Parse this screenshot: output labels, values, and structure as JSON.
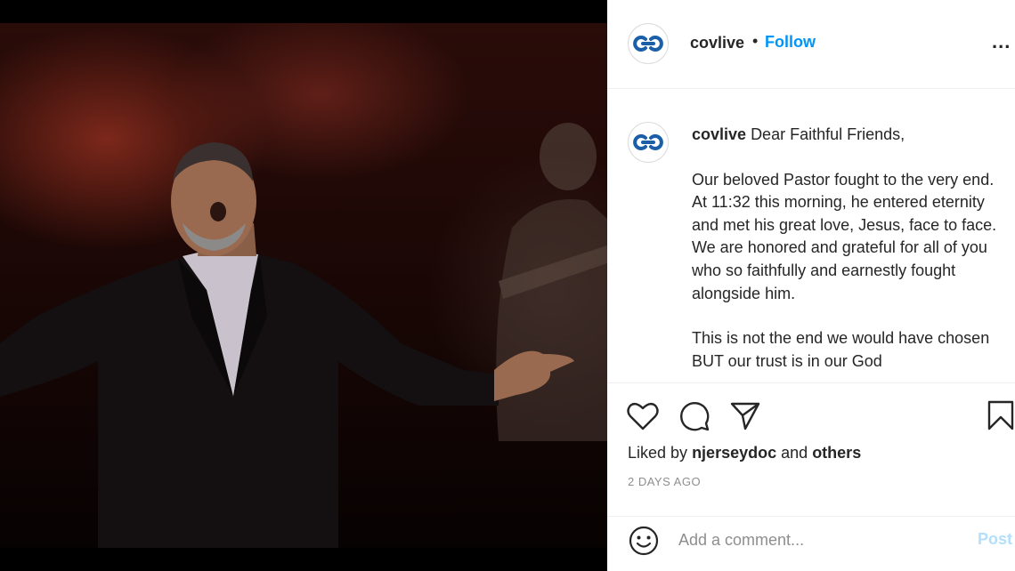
{
  "header": {
    "username": "covlive",
    "separator": "•",
    "follow_label": "Follow",
    "more_label": "..."
  },
  "caption": {
    "username": "covlive",
    "paragraphs": [
      "Dear Faithful Friends,",
      "Our beloved Pastor fought to the very end. At 11:32 this morning, he entered eternity and met his great love, Jesus, face to face. We are honored and grateful for all of you who so faithfully and earnestly fought alongside him.",
      "This is not the end we would have chosen BUT our trust is in our God"
    ]
  },
  "actions": {
    "icons": [
      "heart-icon",
      "comment-icon",
      "share-icon",
      "bookmark-icon"
    ],
    "liked_by_prefix": "Liked by",
    "liked_by_user": "njerseydoc",
    "liked_by_and": "and",
    "liked_by_others": "others",
    "timestamp": "2 DAYS AGO"
  },
  "comment": {
    "placeholder": "Add a comment...",
    "post_label": "Post"
  },
  "colors": {
    "accent": "#0095f6",
    "post_disabled": "#b2dffc",
    "logo": "#1b5fa8"
  }
}
